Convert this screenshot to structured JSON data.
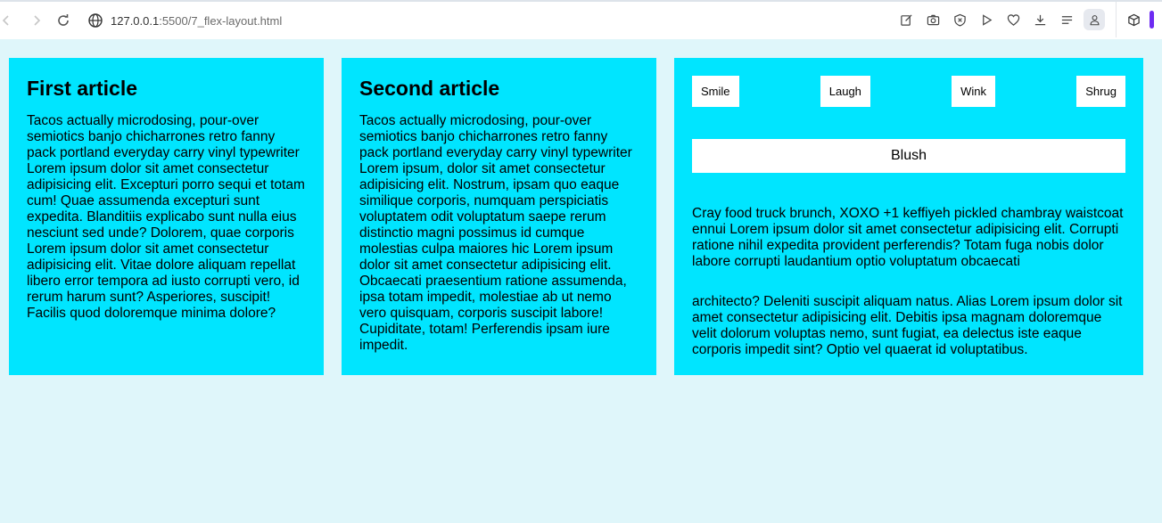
{
  "browser": {
    "url_host": "127.0.0.1",
    "url_path": ":5500/7_flex-layout.html"
  },
  "articles": [
    {
      "title": "First article",
      "body": "Tacos actually microdosing, pour-over semiotics banjo chicharrones retro fanny pack portland everyday carry vinyl typewriter Lorem ipsum dolor sit amet consectetur adipisicing elit. Excepturi porro sequi et totam cum! Quae assumenda excepturi sunt expedita. Blanditiis explicabo sunt nulla eius nesciunt sed unde? Dolorem, quae corporis Lorem ipsum dolor sit amet consectetur adipisicing elit. Vitae dolore aliquam repellat libero error tempora ad iusto corrupti vero, id rerum harum sunt? Asperiores, suscipit! Facilis quod doloremque minima dolore?"
    },
    {
      "title": "Second article",
      "body": "Tacos actually microdosing, pour-over semiotics banjo chicharrones retro fanny pack portland everyday carry vinyl typewriter Lorem ipsum, dolor sit amet consectetur adipisicing elit. Nostrum, ipsam quo eaque similique corporis, numquam perspiciatis voluptatem odit voluptatum saepe rerum distinctio magni possimus id cumque molestias culpa maiores hic Lorem ipsum dolor sit amet consectetur adipisicing elit. Obcaecati praesentium ratione assumenda, ipsa totam impedit, molestiae ab ut nemo vero quisquam, corporis suscipit labore! Cupiditate, totam! Perferendis ipsam iure impedit."
    }
  ],
  "third": {
    "buttons": [
      "Smile",
      "Laugh",
      "Wink",
      "Shrug"
    ],
    "blush_label": "Blush",
    "para1": "Cray food truck brunch, XOXO +1 keffiyeh pickled chambray waistcoat ennui Lorem ipsum dolor sit amet consectetur adipisicing elit. Corrupti ratione nihil expedita provident perferendis? Totam fuga nobis dolor labore corrupti laudantium optio voluptatum obcaecati",
    "para2": "architecto? Deleniti suscipit aliquam natus. Alias Lorem ipsum dolor sit amet consectetur adipisicing elit. Debitis ipsa magnam doloremque velit dolorum voluptas nemo, sunt fugiat, ea delectus iste eaque corporis impedit sint? Optio vel quaerat id voluptatibus."
  },
  "colors": {
    "page_bg": "#dff6fa",
    "card_bg": "#00e5ff",
    "accent_purple": "#6e2bf2"
  }
}
